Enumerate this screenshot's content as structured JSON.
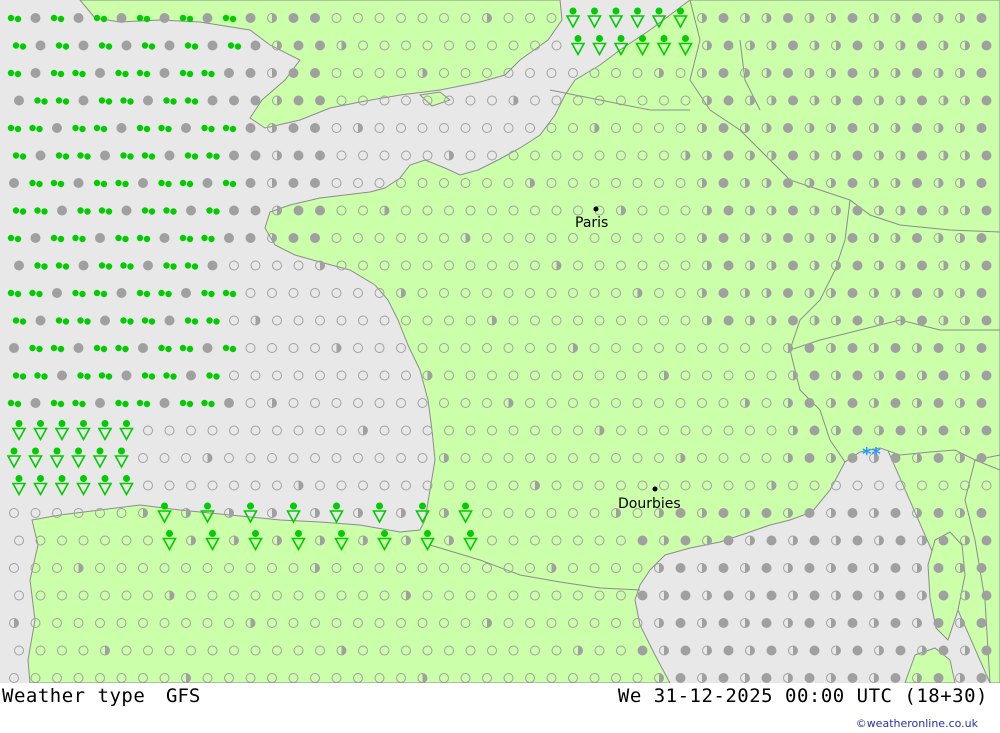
{
  "map": {
    "cities": [
      {
        "name": "Paris",
        "label": "Paris"
      },
      {
        "name": "Dourbies",
        "label": "Dourbies"
      }
    ],
    "special_symbol": "**",
    "colors": {
      "sea": "#e8e8e8",
      "land": "#ccffaa",
      "border": "#8c8c8c",
      "precip": "#00cc00",
      "snow": "#1e9bff",
      "cloud_overcast": "#a0a0a0"
    }
  },
  "footer": {
    "title": "Weather type",
    "model": "GFS",
    "valid": "We 31-12-2025 00:00 UTC (18+30)",
    "credit": "©weatheronline.co.uk"
  }
}
